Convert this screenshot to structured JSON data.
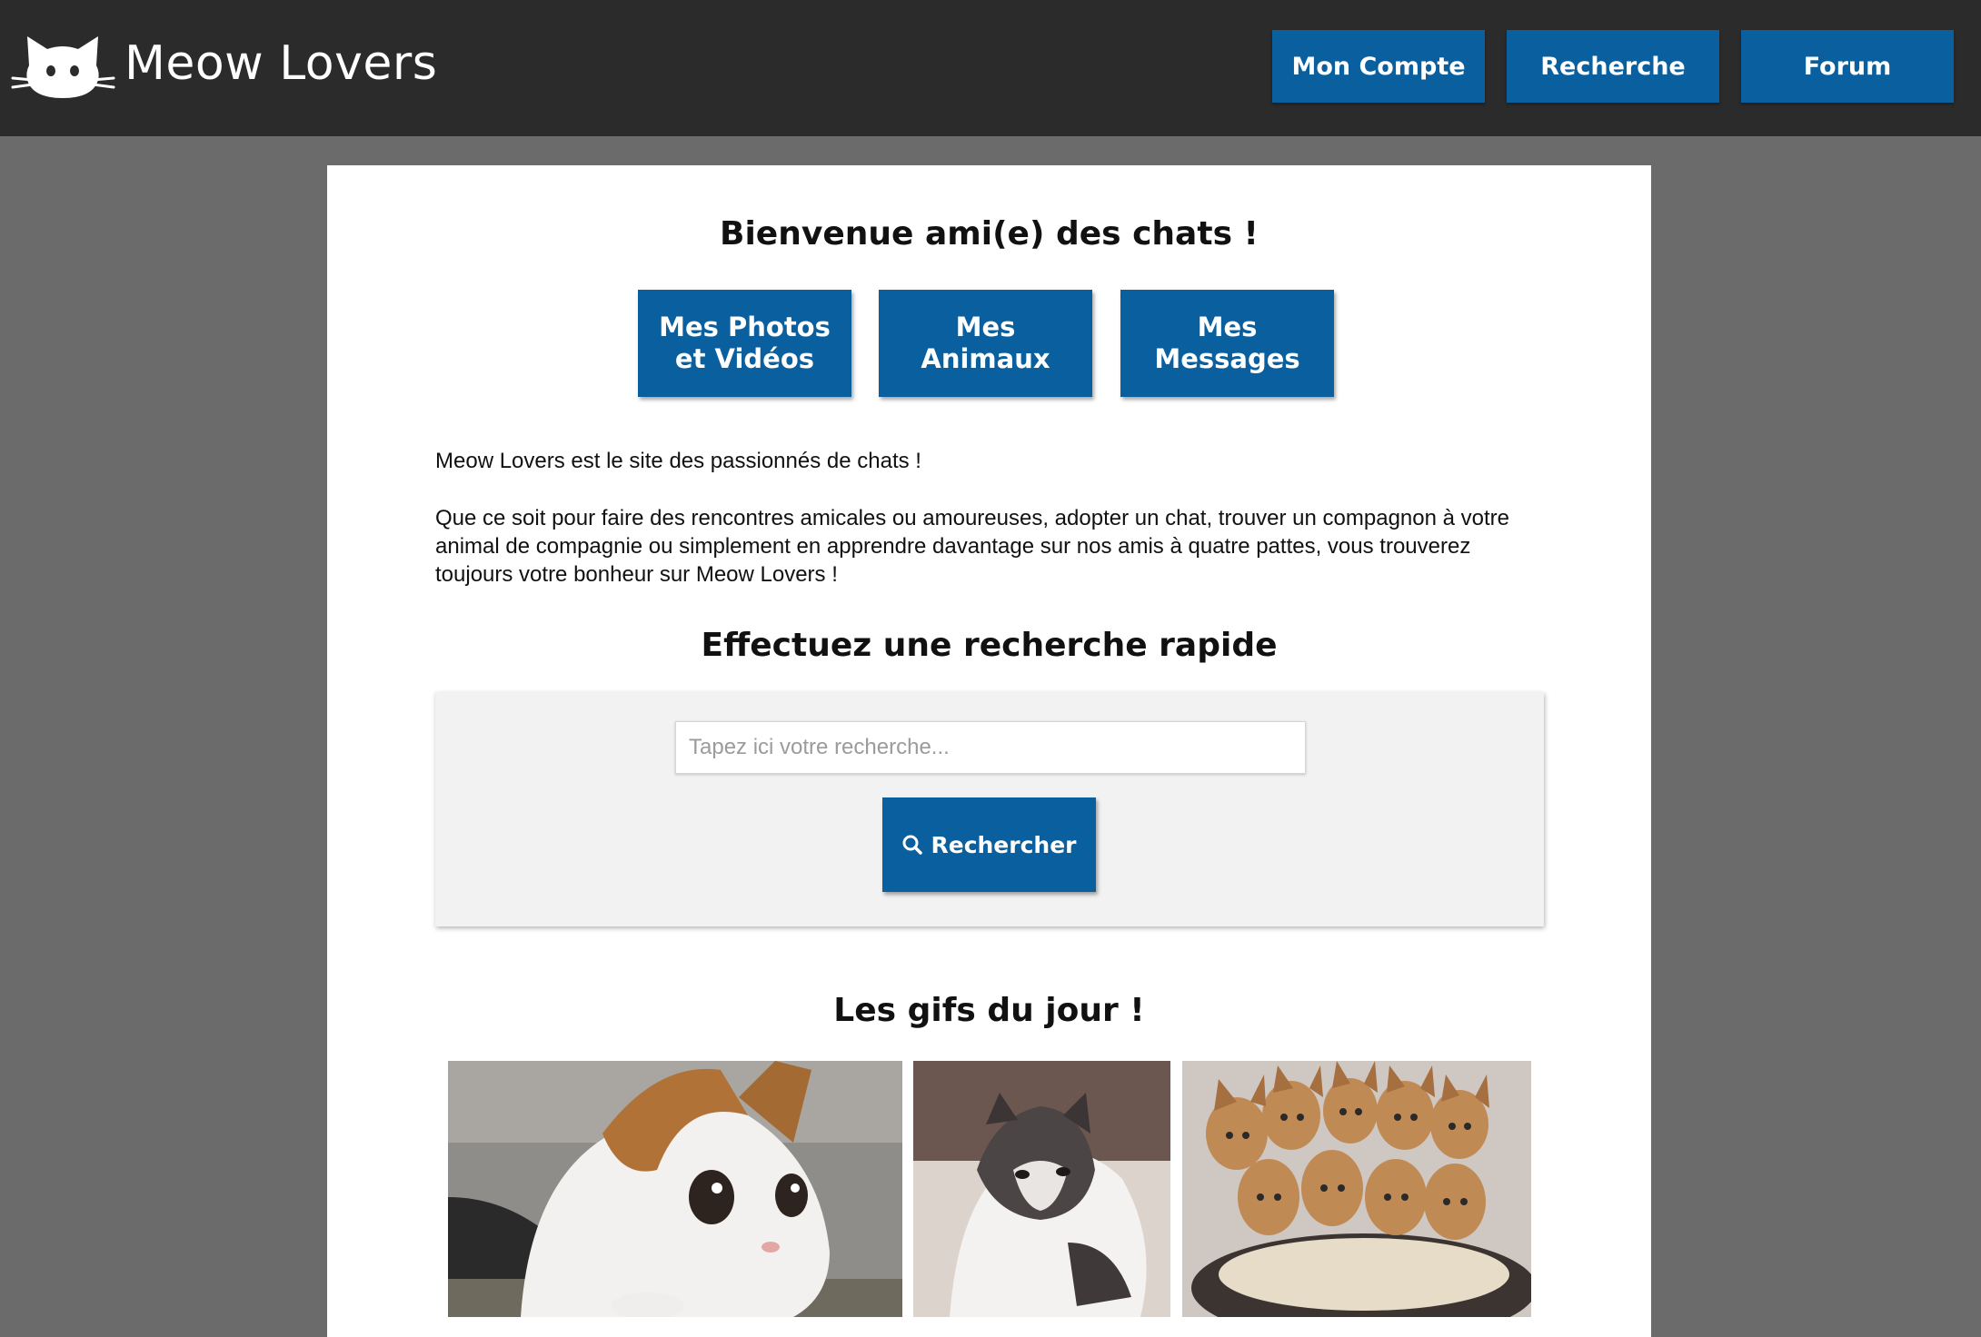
{
  "header": {
    "brand": "Meow Lovers",
    "nav": {
      "account": "Mon Compte",
      "search": "Recherche",
      "forum": "Forum"
    }
  },
  "main": {
    "welcome_title": "Bienvenue ami(e) des chats !",
    "features": {
      "photos_line1": "Mes Photos",
      "photos_line2": "et Vidéos",
      "animals_line1": "Mes",
      "animals_line2": "Animaux",
      "messages_line1": "Mes",
      "messages_line2": "Messages"
    },
    "intro_1": "Meow Lovers est le site des passionnés de chats !",
    "intro_2": "Que ce soit pour faire des rencontres amicales ou amoureuses, adopter un chat, trouver un compagnon à votre animal de compagnie ou simplement en apprendre davantage sur nos amis à quatre pattes, vous trouverez toujours votre bonheur sur Meow Lovers !",
    "quick_search_title": "Effectuez une recherche rapide",
    "search": {
      "placeholder": "Tapez ici votre recherche...",
      "button": "Rechercher"
    },
    "gifs_title": "Les gifs du jour !"
  },
  "colors": {
    "header_bg": "#2b2b2b",
    "page_bg": "#6b6b6b",
    "accent_blue": "#0a5f9e",
    "panel_bg": "#f2f2f2"
  },
  "icons": {
    "logo": "cat-head-icon",
    "search": "magnifier-icon"
  }
}
